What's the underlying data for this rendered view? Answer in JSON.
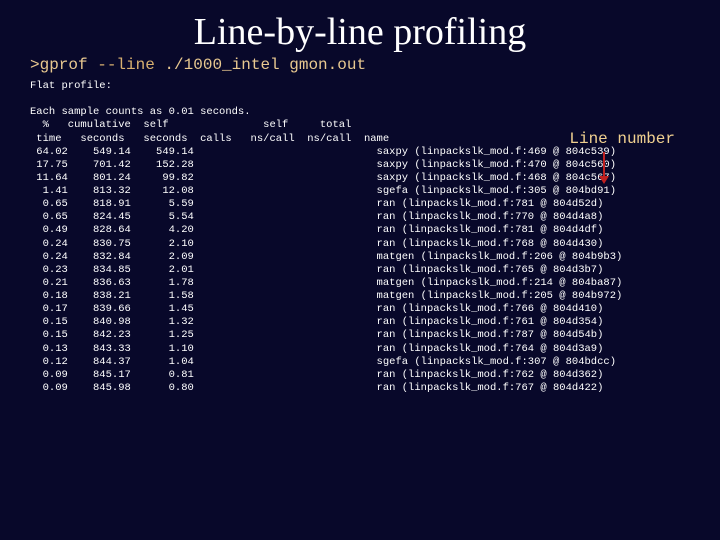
{
  "title": "Line-by-line profiling",
  "command": {
    "prompt": ">gprof ",
    "option": "--line",
    "rest": " ./1000_intel gmon.out"
  },
  "flat_label": "Flat profile:",
  "sample_line": "Each sample counts as 0.01 seconds.",
  "annotation": "Line number",
  "header1": {
    "pct": "%",
    "cum": "cumulative",
    "self": "self",
    "selfc": "self",
    "total": "total"
  },
  "header2": {
    "time": "time",
    "sec": "seconds",
    "selfsec": "seconds",
    "calls": "calls",
    "nscall": "ns/call",
    "nscall2": "ns/call",
    "name": "name"
  },
  "rows": [
    {
      "pct": "64.02",
      "cum": "549.14",
      "self": "549.14",
      "name": "saxpy (linpackslk_mod.f:469 @ 804c539)"
    },
    {
      "pct": "17.75",
      "cum": "701.42",
      "self": "152.28",
      "name": "saxpy (linpackslk_mod.f:470 @ 804c560)"
    },
    {
      "pct": "11.64",
      "cum": "801.24",
      "self": "99.82",
      "name": "saxpy (linpackslk_mod.f:468 @ 804c567)"
    },
    {
      "pct": "1.41",
      "cum": "813.32",
      "self": "12.08",
      "name": "sgefa (linpackslk_mod.f:305 @ 804bd91)"
    },
    {
      "pct": "0.65",
      "cum": "818.91",
      "self": "5.59",
      "name": "ran (linpackslk_mod.f:781 @ 804d52d)"
    },
    {
      "pct": "0.65",
      "cum": "824.45",
      "self": "5.54",
      "name": "ran (linpackslk_mod.f:770 @ 804d4a8)"
    },
    {
      "pct": "0.49",
      "cum": "828.64",
      "self": "4.20",
      "name": "ran (linpackslk_mod.f:781 @ 804d4df)"
    },
    {
      "pct": "0.24",
      "cum": "830.75",
      "self": "2.10",
      "name": "ran (linpackslk_mod.f:768 @ 804d430)"
    },
    {
      "pct": "0.24",
      "cum": "832.84",
      "self": "2.09",
      "name": "matgen (linpackslk_mod.f:206 @ 804b9b3)"
    },
    {
      "pct": "0.23",
      "cum": "834.85",
      "self": "2.01",
      "name": "ran (linpackslk_mod.f:765 @ 804d3b7)"
    },
    {
      "pct": "0.21",
      "cum": "836.63",
      "self": "1.78",
      "name": "matgen (linpackslk_mod.f:214 @ 804ba87)"
    },
    {
      "pct": "0.18",
      "cum": "838.21",
      "self": "1.58",
      "name": "matgen (linpackslk_mod.f:205 @ 804b972)"
    },
    {
      "pct": "0.17",
      "cum": "839.66",
      "self": "1.45",
      "name": "ran (linpackslk_mod.f:766 @ 804d410)"
    },
    {
      "pct": "0.15",
      "cum": "840.98",
      "self": "1.32",
      "name": "ran (linpackslk_mod.f:761 @ 804d354)"
    },
    {
      "pct": "0.15",
      "cum": "842.23",
      "self": "1.25",
      "name": "ran (linpackslk_mod.f:787 @ 804d54b)"
    },
    {
      "pct": "0.13",
      "cum": "843.33",
      "self": "1.10",
      "name": "ran (linpackslk_mod.f:764 @ 804d3a9)"
    },
    {
      "pct": "0.12",
      "cum": "844.37",
      "self": "1.04",
      "name": "sgefa (linpackslk_mod.f:307 @ 804bdcc)"
    },
    {
      "pct": "0.09",
      "cum": "845.17",
      "self": "0.81",
      "name": "ran (linpackslk_mod.f:762 @ 804d362)"
    },
    {
      "pct": "0.09",
      "cum": "845.98",
      "self": "0.80",
      "name": "ran (linpackslk_mod.f:767 @ 804d422)"
    }
  ]
}
